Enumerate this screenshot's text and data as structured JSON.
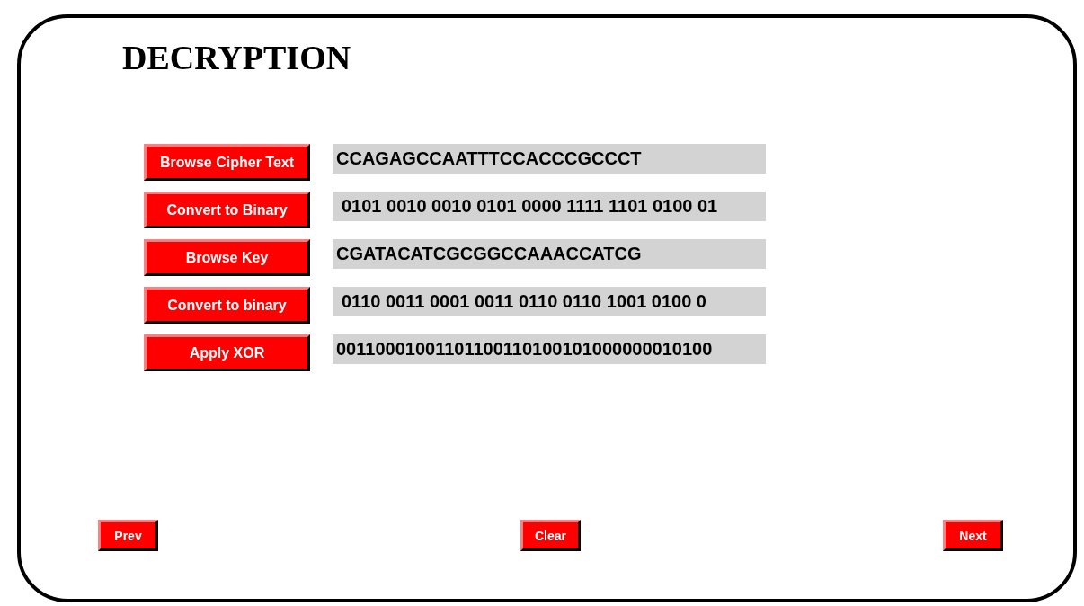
{
  "title": "DECRYPTION",
  "rows": [
    {
      "button": "Browse Cipher Text",
      "value": "CCAGAGCCAATTTCCACCCGCCCT",
      "indent": false
    },
    {
      "button": "Convert to Binary",
      "value": "0101 0010 0010 0101 0000 1111 1101 0100 01",
      "indent": true
    },
    {
      "button": "Browse Key",
      "value": "CGATACATCGCGGCCAAACCATCG",
      "indent": false
    },
    {
      "button": "Convert to binary",
      "value": "0110 0011 0001 0011 0110 0110 1001 0100 0",
      "indent": true
    },
    {
      "button": "Apply XOR",
      "value": "00110001001101100110100101000000010100",
      "indent": false
    }
  ],
  "nav": [
    "Prev",
    "Clear",
    "Next"
  ]
}
